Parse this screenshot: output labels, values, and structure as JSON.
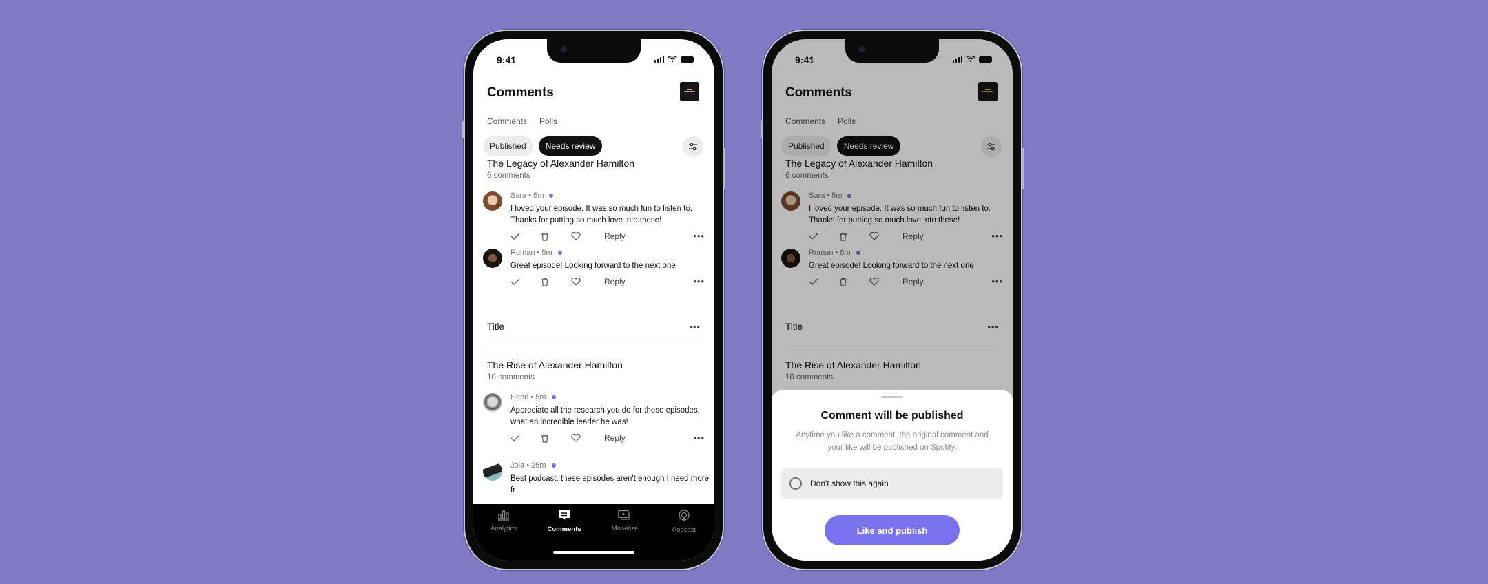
{
  "colors": {
    "background": "#8079c4",
    "accent": "#7b72f0",
    "unread_dot": "#7b70e0"
  },
  "status_bar": {
    "time": "9:41",
    "icons": [
      "cellular-signal-icon",
      "wifi-icon",
      "battery-icon"
    ]
  },
  "header": {
    "title": "Comments",
    "cover_icon": "podcast-cover-thumbnail"
  },
  "tabs": [
    {
      "label": "Comments"
    },
    {
      "label": "Polls"
    }
  ],
  "chips": [
    {
      "label": "Published",
      "selected": false
    },
    {
      "label": "Needs review",
      "selected": true
    }
  ],
  "filter_icon": "sliders-icon",
  "episodes": [
    {
      "title": "The Legacy of Alexander Hamilton",
      "count": "6 comments",
      "comments": [
        {
          "author": "Sara",
          "time": "5m",
          "text": "I loved your episode. It was so much fun to listen to. Thanks for putting so much love into these!",
          "unread": true
        },
        {
          "author": "Roman",
          "time": "5m",
          "text": "Great episode! Looking forward to the next one",
          "unread": true
        }
      ]
    },
    {
      "title": "Title",
      "count": "",
      "comments": []
    },
    {
      "title": "The Rise of Alexander Hamilton",
      "count": "10 comments",
      "comments": [
        {
          "author": "Henri",
          "time": "5m",
          "text": "Appreciate all the research you do for these episodes, what an incredible leader he was!",
          "unread": true
        },
        {
          "author": "Jola",
          "time": "25m",
          "text": "Best podcast, these episodes aren't enough I need more fr",
          "unread": true
        }
      ]
    }
  ],
  "meta": {
    "sara": "Sara • 5m",
    "roman": "Roman • 5m",
    "henri": "Henri • 5m",
    "jola": "Jola • 25m"
  },
  "actions": {
    "approve_icon": "check-icon",
    "delete_icon": "trash-icon",
    "like_icon": "heart-icon",
    "reply_label": "Reply",
    "more_label": "•••"
  },
  "bottom_nav": [
    {
      "label": "Analytics",
      "icon": "bar-chart-icon",
      "active": false
    },
    {
      "label": "Comments",
      "icon": "comment-icon",
      "active": true
    },
    {
      "label": "Monetize",
      "icon": "monetize-icon",
      "active": false
    },
    {
      "label": "Podcast",
      "icon": "podcast-icon",
      "active": false
    }
  ],
  "sheet": {
    "title": "Comment will be published",
    "body": "Anytime you like a comment, the original comment and your like will be published on Spotify.",
    "checkbox_label": "Don't show this again",
    "checkbox_checked": false,
    "primary_button": "Like and publish"
  }
}
